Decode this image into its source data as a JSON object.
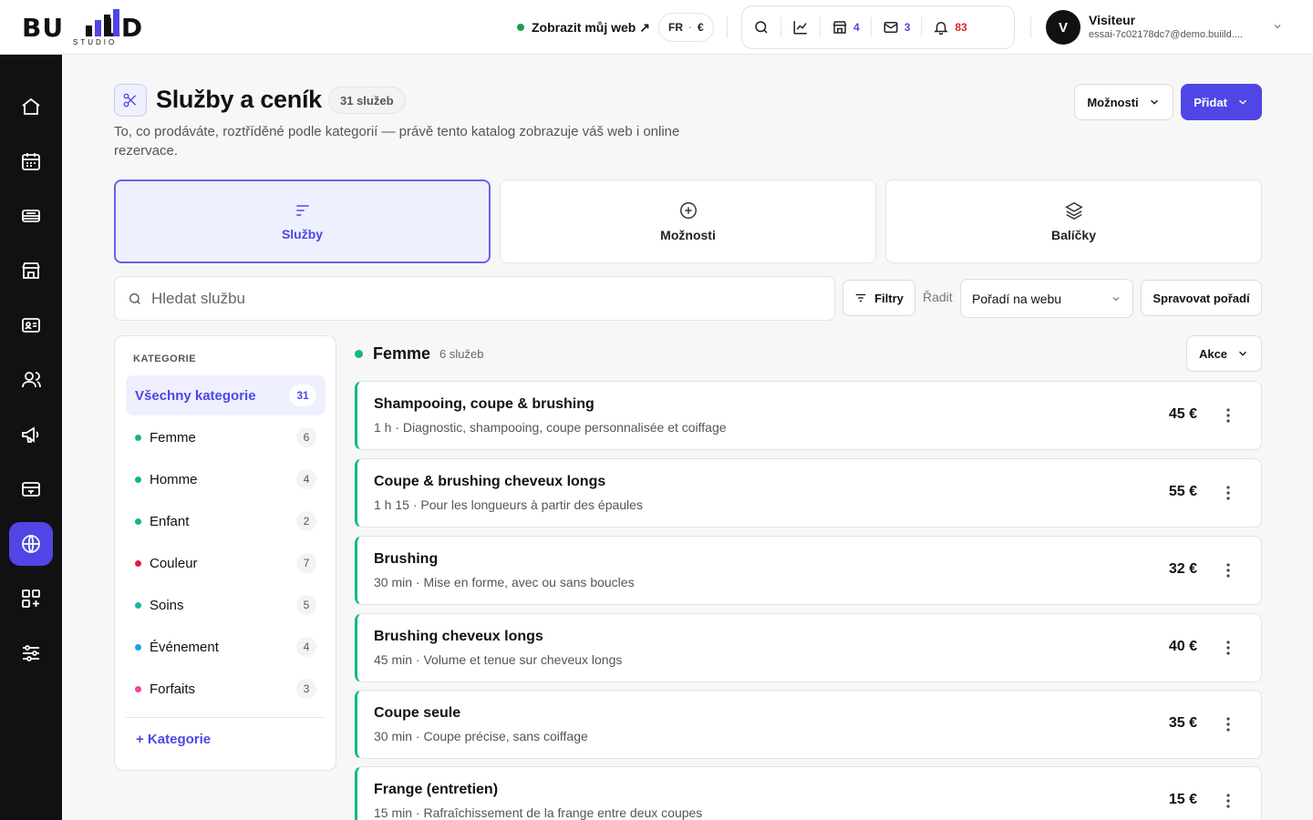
{
  "brand": {
    "logo_text": "BU  LD",
    "logo_sub": "STUDIO"
  },
  "header": {
    "view_web_label": "Zobrazit můj web ↗",
    "lang": "FR",
    "currency": "€",
    "badges": {
      "shop": "4",
      "mail": "3",
      "bell": "83"
    },
    "user": {
      "initial": "V",
      "name": "Visiteur",
      "email": "essai-7c02178dc7@demo.buiild...."
    }
  },
  "page": {
    "title": "Služby a ceník",
    "count_label": "31 služeb",
    "description": "To, co prodáváte, roztříděné podle kategorií — právě tento katalog zobrazuje váš web i online rezervace.",
    "options_label": "Možnosti",
    "add_label": "Přidat"
  },
  "tabs": [
    {
      "label": "Služby",
      "icon": "lines-icon",
      "active": true
    },
    {
      "label": "Možnosti",
      "icon": "plus-circle-icon",
      "active": false
    },
    {
      "label": "Balíčky",
      "icon": "layers-icon",
      "active": false
    }
  ],
  "toolbar": {
    "search_placeholder": "Hledat službu",
    "search_value": "",
    "filters_label": "Filtry",
    "sort_label": "Řadit",
    "sort_value": "Pořadí na webu",
    "manage_order_label": "Spravovat pořadí"
  },
  "categories": {
    "heading": "KATEGORIE",
    "all": {
      "label": "Všechny kategorie",
      "count": "31"
    },
    "items": [
      {
        "label": "Femme",
        "count": "6",
        "color": "#10b981"
      },
      {
        "label": "Homme",
        "count": "4",
        "color": "#10b981"
      },
      {
        "label": "Enfant",
        "count": "2",
        "color": "#10b981"
      },
      {
        "label": "Couleur",
        "count": "7",
        "color": "#e11d48"
      },
      {
        "label": "Soins",
        "count": "5",
        "color": "#14b8a6"
      },
      {
        "label": "Événement",
        "count": "4",
        "color": "#0ea5e9"
      },
      {
        "label": "Forfaits",
        "count": "3",
        "color": "#ec4899"
      }
    ],
    "add_label": "+ Kategorie"
  },
  "group": {
    "name": "Femme",
    "count_label": "6 služeb",
    "actions_label": "Akce",
    "color": "#10b981"
  },
  "services": [
    {
      "name": "Shampooing, coupe & brushing",
      "desc": "1 h · Diagnostic, shampooing, coupe personnalisée et coiffage",
      "price": "45 €"
    },
    {
      "name": "Coupe & brushing cheveux longs",
      "desc": "1 h 15 · Pour les longueurs à partir des épaules",
      "price": "55 €"
    },
    {
      "name": "Brushing",
      "desc": "30 min · Mise en forme, avec ou sans boucles",
      "price": "32 €"
    },
    {
      "name": "Brushing cheveux longs",
      "desc": "45 min · Volume et tenue sur cheveux longs",
      "price": "40 €"
    },
    {
      "name": "Coupe seule",
      "desc": "30 min · Coupe précise, sans coiffage",
      "price": "35 €"
    },
    {
      "name": "Frange (entretien)",
      "desc": "15 min · Rafraîchissement de la frange entre deux coupes",
      "price": "15 €"
    }
  ],
  "sidebar": {
    "items": [
      {
        "icon": "home-icon",
        "active": false
      },
      {
        "icon": "calendar-icon",
        "active": false
      },
      {
        "icon": "inbox-icon",
        "active": false
      },
      {
        "icon": "store-icon",
        "active": false
      },
      {
        "icon": "contact-card-icon",
        "active": false
      },
      {
        "icon": "users-icon",
        "active": false
      },
      {
        "icon": "megaphone-icon",
        "active": false
      },
      {
        "icon": "payment-card-icon",
        "active": false
      },
      {
        "icon": "globe-icon",
        "active": true
      },
      {
        "icon": "apps-add-icon",
        "active": false
      },
      {
        "icon": "sliders-icon",
        "active": false
      }
    ]
  }
}
